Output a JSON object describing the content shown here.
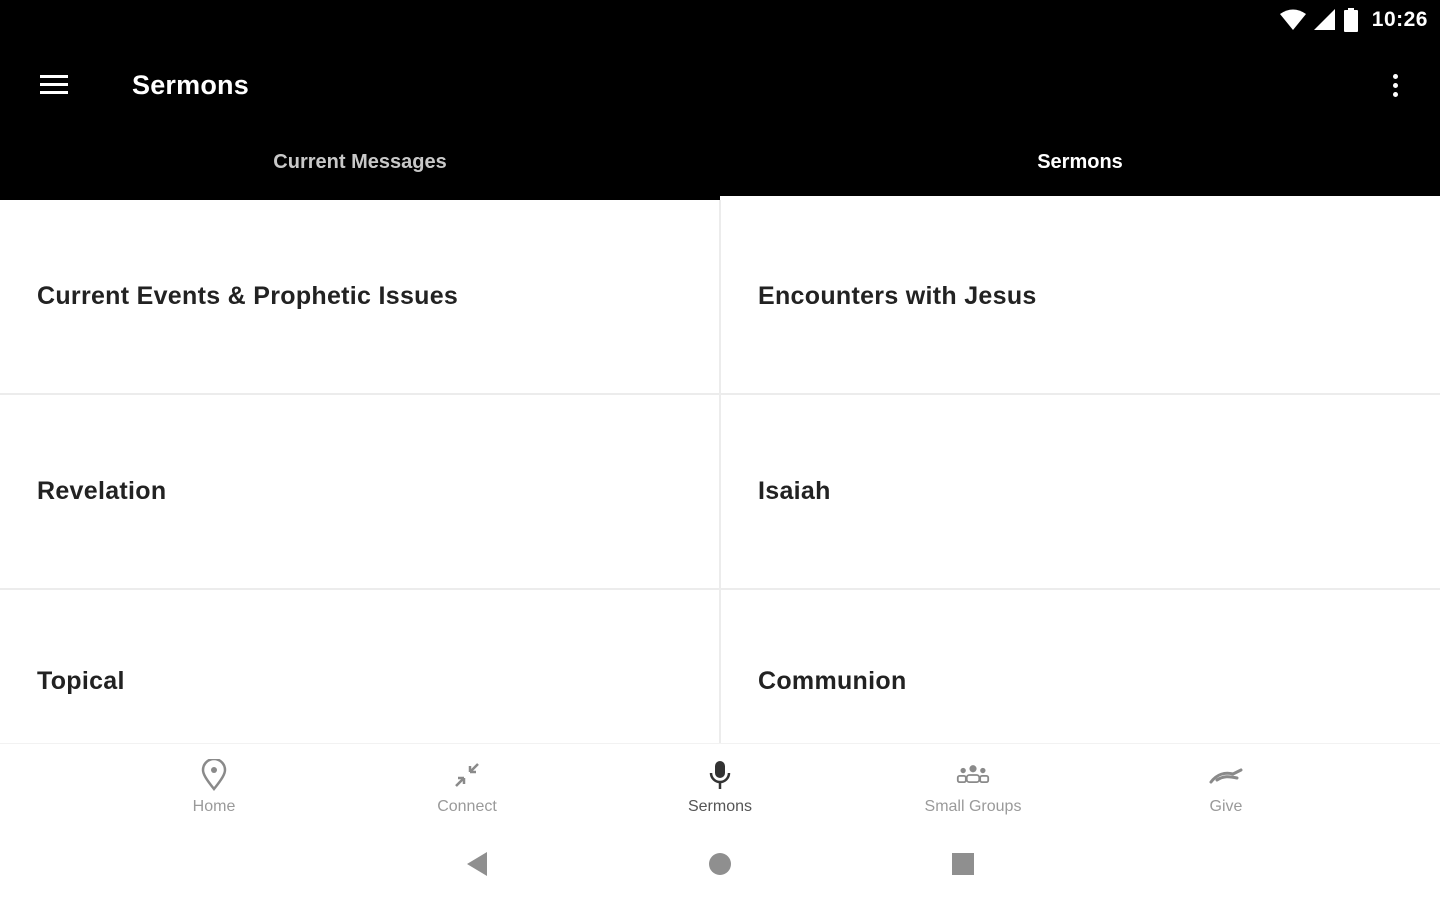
{
  "status_bar": {
    "time": "10:26",
    "icons": [
      "wifi-icon",
      "cell-signal-icon",
      "battery-icon"
    ]
  },
  "app_bar": {
    "menu_icon": "hamburger-menu-icon",
    "title": "Sermons",
    "overflow_icon": "more-vert-icon"
  },
  "tabs": [
    {
      "label": "Current Messages",
      "active": false
    },
    {
      "label": "Sermons",
      "active": true
    }
  ],
  "categories": [
    {
      "label": "Current Events & Prophetic Issues"
    },
    {
      "label": "Encounters with Jesus"
    },
    {
      "label": "Revelation"
    },
    {
      "label": "Isaiah"
    },
    {
      "label": "Topical"
    },
    {
      "label": "Communion"
    }
  ],
  "bottom_nav": [
    {
      "label": "Home",
      "icon": "location-pin-icon",
      "active": false
    },
    {
      "label": "Connect",
      "icon": "arrows-inward-icon",
      "active": false
    },
    {
      "label": "Sermons",
      "icon": "microphone-icon",
      "active": true
    },
    {
      "label": "Small Groups",
      "icon": "group-icon",
      "active": false
    },
    {
      "label": "Give",
      "icon": "giving-hand-icon",
      "active": false
    }
  ],
  "system_nav": {
    "back_icon": "back-triangle-icon",
    "home_icon": "home-circle-icon",
    "recents_icon": "recents-square-icon"
  },
  "colors": {
    "app_bar_bg": "#000000",
    "tab_active": "#ffffff",
    "tab_inactive": "#c8c8c8",
    "cell_text": "#222222",
    "nav_label": "#9a9a9a"
  }
}
